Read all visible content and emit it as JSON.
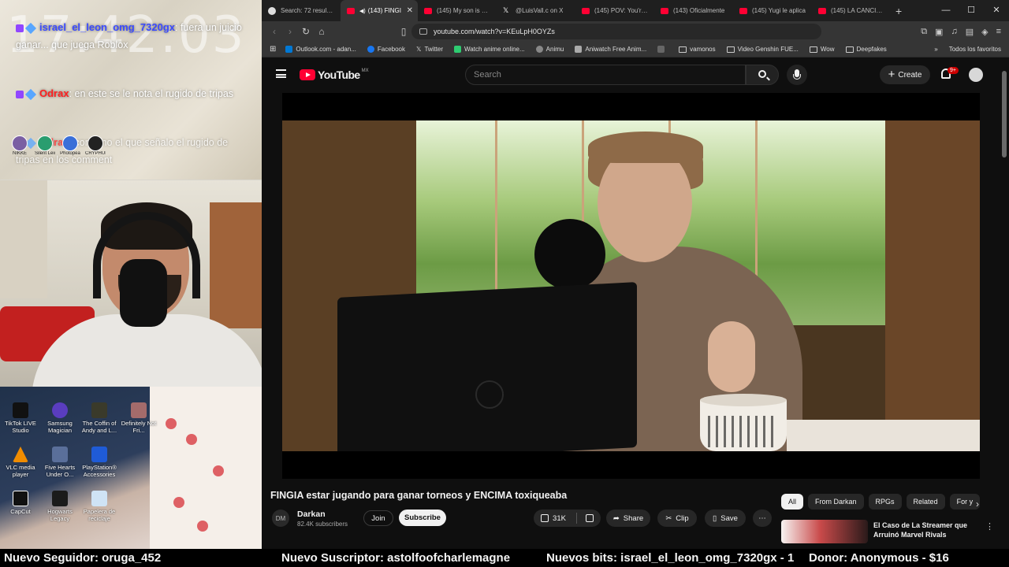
{
  "overlay": {
    "clock": "17:42:03",
    "chat": [
      {
        "user": "israel_el_leon_omg_7320gx",
        "text": ": fuera un juicio ganar... que juega Roblox"
      },
      {
        "user": "Odrax",
        "text": ": en este se le nota el rugido de tripas"
      },
      {
        "user": "Odrax",
        "text": ": como no el que señalo el rugido de tripas en los comment"
      }
    ],
    "viewers": [
      "NIKKE",
      "Silent Leica",
      "Photopea",
      "CRYPHUNK"
    ],
    "desktop_icons": [
      {
        "label": "TikTok LIVE Studio",
        "color": "#111111"
      },
      {
        "label": "Samsung Magician",
        "color": "#5a3dbf"
      },
      {
        "label": "The Coffin of Andy and L...",
        "color": "#3a3a2a"
      },
      {
        "label": "Definitely Not Fri...",
        "color": "#a46b6b"
      },
      {
        "label": "VLC media player",
        "color": "#f08c00"
      },
      {
        "label": "Five Hearts Under O...",
        "color": "#5a6f9a"
      },
      {
        "label": "PlayStation® Accessories",
        "color": "#1f5bd6"
      },
      {
        "label": "CapCut",
        "color": "#111111"
      },
      {
        "label": "Hogwarts Legacy",
        "color": "#1b1b1b"
      },
      {
        "label": "Papelera de reciclaje",
        "color": "#cfe3f5"
      }
    ]
  },
  "browser": {
    "tabs": [
      {
        "label": "Search: 72 results f",
        "icon": "globe-icon"
      },
      {
        "label": "(143) FINGI",
        "icon": "youtube-icon",
        "active": true
      },
      {
        "label": "(145) My son is a T",
        "icon": "youtube-icon"
      },
      {
        "label": "@LuisVall.ᴄ on X",
        "icon": "x-icon"
      },
      {
        "label": "(145) POV: You're a",
        "icon": "youtube-icon"
      },
      {
        "label": "(143) Oficialmente",
        "icon": "youtube-icon"
      },
      {
        "label": "(145) Yugi le aplica",
        "icon": "youtube-icon"
      },
      {
        "label": "(145) LA CANCIÓN",
        "icon": "youtube-icon"
      }
    ],
    "url": "youtube.com/watch?v=KEuLpH0OYZs",
    "bookmarks": [
      {
        "label": "Outlook.com - adan...",
        "color": "#0078d4"
      },
      {
        "label": "Facebook",
        "color": "#1877f2"
      },
      {
        "label": "Twitter",
        "color": "#000000"
      },
      {
        "label": "Watch anime online...",
        "color": "#2ecc71"
      },
      {
        "label": "Animu",
        "color": "#888888"
      },
      {
        "label": "Aniwatch Free Anim...",
        "color": "#aaaaaa"
      },
      {
        "label": "",
        "color": "#666666"
      },
      {
        "label": "vamonos",
        "folder": true
      },
      {
        "label": "Video Genshin FUE...",
        "folder": true
      },
      {
        "label": "Wow",
        "folder": true
      },
      {
        "label": "Deepfakes",
        "folder": true
      }
    ],
    "bookmarks_all": "Todos los favoritos"
  },
  "youtube": {
    "logo": "YouTube",
    "logo_country": "MX",
    "search_placeholder": "Search",
    "create_label": "Create",
    "notifications": "9+",
    "video_title": "FINGIA estar jugando para ganar torneos y ENCIMA toxiqueaba",
    "channel": {
      "name": "Darkan",
      "subscribers": "82.4K subscribers",
      "avatar_text": "DM"
    },
    "join_label": "Join",
    "subscribe_label": "Subscribe",
    "likes": "31K",
    "share_label": "Share",
    "clip_label": "Clip",
    "save_label": "Save",
    "chips": [
      "All",
      "From Darkan",
      "RPGs",
      "Related",
      "For y"
    ],
    "recommendation": {
      "title": "El Caso de La Streamer que Arruinó Marvel Rivals"
    }
  },
  "ticker": {
    "follower": "Nuevo Seguidor: oruga_452",
    "subscriber": "Nuevo Suscriptor: astolfoofcharlemagne",
    "bits": "Nuevos bits: israel_el_leon_omg_7320gx - 1",
    "donor": "Donor: Anonymous - $16"
  }
}
